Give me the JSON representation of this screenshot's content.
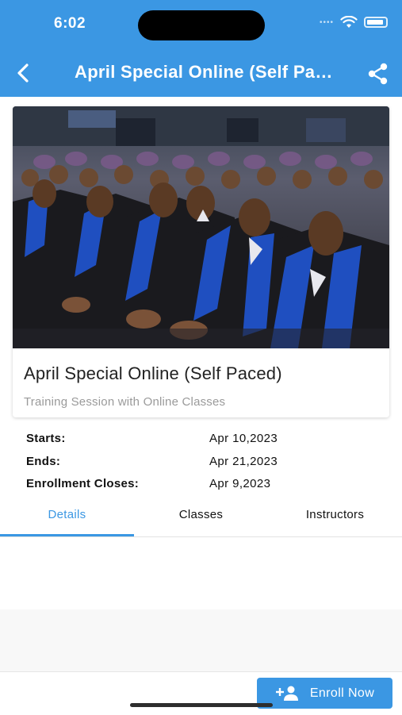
{
  "status_bar": {
    "time": "6:02"
  },
  "header": {
    "title": "April Special Online (Self Paced)",
    "back_icon": "chevron-left-icon",
    "share_icon": "share-icon",
    "background": "#3b97e3"
  },
  "course": {
    "title": "April Special Online (Self Paced)",
    "subtitle": "Training Session with Online Classes",
    "image": "graduation-ceremony-photo"
  },
  "info": [
    {
      "label": "Starts:",
      "value": "Apr 10,2023"
    },
    {
      "label": "Ends:",
      "value": "Apr 21,2023"
    },
    {
      "label": "Enrollment Closes:",
      "value": "Apr 9,2023"
    }
  ],
  "tabs": [
    {
      "label": "Details",
      "active": true
    },
    {
      "label": "Classes",
      "active": false
    },
    {
      "label": "Instructors",
      "active": false
    }
  ],
  "enroll_button": {
    "label": "Enroll Now",
    "icon": "add-person-icon"
  },
  "colors": {
    "accent": "#3b97e3",
    "subtitle": "#9a9a9a",
    "text": "#111111"
  }
}
